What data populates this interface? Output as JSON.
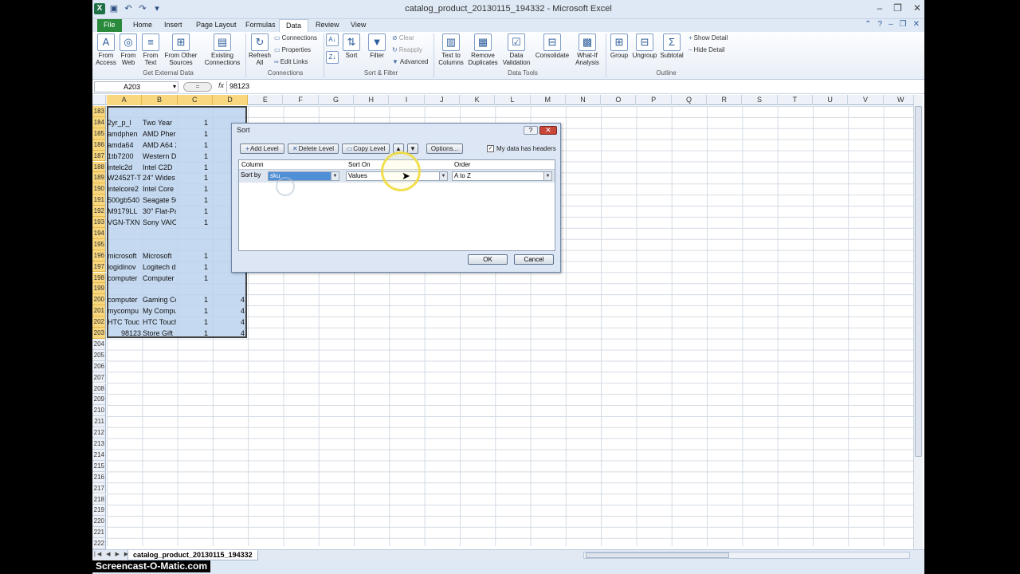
{
  "window": {
    "title": "catalog_product_20130115_194332 - Microsoft Excel"
  },
  "tabs": [
    "File",
    "Home",
    "Insert",
    "Page Layout",
    "Formulas",
    "Data",
    "Review",
    "View"
  ],
  "ribbon": {
    "get_external": {
      "from_access": "From Access",
      "from_web": "From Web",
      "from_text": "From Text",
      "from_other": "From Other Sources",
      "existing": "Existing Connections",
      "label": "Get External Data"
    },
    "connections": {
      "refresh": "Refresh All",
      "connections": "Connections",
      "properties": "Properties",
      "edit_links": "Edit Links",
      "label": "Connections"
    },
    "sort_filter": {
      "sort": "Sort",
      "filter": "Filter",
      "clear": "Clear",
      "reapply": "Reapply",
      "advanced": "Advanced",
      "label": "Sort & Filter"
    },
    "data_tools": {
      "text_to_columns": "Text to Columns",
      "remove_duplicates": "Remove Duplicates",
      "data_validation": "Data Validation",
      "consolidate": "Consolidate",
      "what_if": "What-If Analysis",
      "label": "Data Tools"
    },
    "outline": {
      "group": "Group",
      "ungroup": "Ungroup",
      "subtotal": "Subtotal",
      "show_detail": "Show Detail",
      "hide_detail": "Hide Detail",
      "label": "Outline"
    }
  },
  "formula_bar": {
    "name_box": "A203",
    "fx": "fx",
    "value": "98123"
  },
  "columns": [
    "A",
    "B",
    "C",
    "D",
    "E",
    "F",
    "G",
    "H",
    "I",
    "J",
    "K",
    "L",
    "M",
    "N",
    "O",
    "P",
    "Q",
    "R",
    "S",
    "T",
    "U",
    "V",
    "W"
  ],
  "rows": [
    "183",
    "184",
    "185",
    "186",
    "187",
    "188",
    "189",
    "190",
    "191",
    "192",
    "193",
    "194",
    "195",
    "196",
    "197",
    "198",
    "199",
    "200",
    "201",
    "202",
    "203",
    "204",
    "205",
    "206",
    "207",
    "208",
    "209",
    "210",
    "211",
    "212",
    "213",
    "214",
    "215",
    "216",
    "217",
    "218",
    "219",
    "220",
    "221",
    "222",
    "223"
  ],
  "cells": [
    {
      "r": "184",
      "a": "2yr_p_l",
      "b": "Two Year",
      "c": "1"
    },
    {
      "r": "185",
      "a": "amdphen",
      "b": "AMD Pher",
      "c": "1"
    },
    {
      "r": "186",
      "a": "amda64",
      "b": "AMD A64 2",
      "c": "1"
    },
    {
      "r": "187",
      "a": "1tb7200",
      "b": "Western D",
      "c": "1"
    },
    {
      "r": "188",
      "a": "intelc2d",
      "b": "Intel C2D",
      "c": "1"
    },
    {
      "r": "189",
      "a": "W2452T-T",
      "b": "24\" Wides",
      "c": "1"
    },
    {
      "r": "190",
      "a": "intelcore2",
      "b": "Intel Core",
      "c": "1"
    },
    {
      "r": "191",
      "a": "500gb540",
      "b": "Seagate 50",
      "c": "1"
    },
    {
      "r": "192",
      "a": "M9179LL",
      "b": "30\" Flat-Pa",
      "c": "1"
    },
    {
      "r": "193",
      "a": "VGN-TXN",
      "b": "Sony VAIO",
      "c": "1"
    },
    {
      "r": "196",
      "a": "microsoft",
      "b": "Microsoft",
      "c": "1"
    },
    {
      "r": "197",
      "a": "logidinov",
      "b": "Logitech d",
      "c": "1"
    },
    {
      "r": "198",
      "a": "computer",
      "b": "Computer",
      "c": "1"
    },
    {
      "r": "200",
      "a": "computer",
      "b": "Gaming Co",
      "c": "1",
      "d": "4"
    },
    {
      "r": "201",
      "a": "mycompu",
      "b": "My Compu",
      "c": "1",
      "d": "4"
    },
    {
      "r": "202",
      "a": "HTC Touc",
      "b": "HTC Touch",
      "c": "1",
      "d": "4"
    },
    {
      "r": "203",
      "a": "98123",
      "b": "Store Gift",
      "c": "1",
      "d": "4"
    }
  ],
  "sheet_tab": "catalog_product_20130115_194332",
  "watermark": "Screencast-O-Matic.com",
  "dialog": {
    "title": "Sort",
    "help": "?",
    "close": "✕",
    "add_level": "Add Level",
    "delete_level": "Delete Level",
    "copy_level": "Copy Level",
    "options": "Options...",
    "headers_label": "My data has headers",
    "col_header": "Column",
    "sorton_header": "Sort On",
    "order_header": "Order",
    "sort_by": "Sort by",
    "column_value": "sku",
    "sorton_value": "Values",
    "order_value": "A to Z",
    "ok": "OK",
    "cancel": "Cancel"
  }
}
